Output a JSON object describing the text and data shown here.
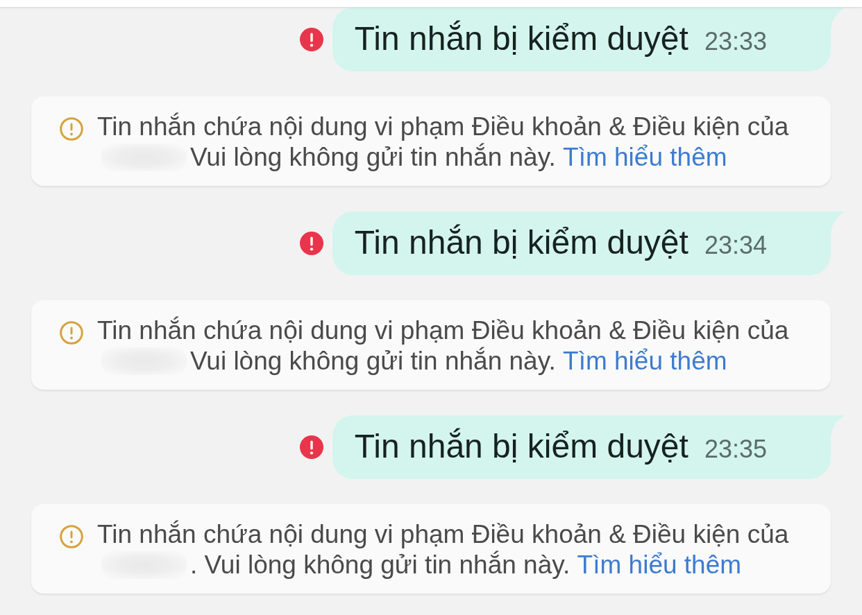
{
  "messages": [
    {
      "text": "Tin nhắn bị kiểm duyệt",
      "time": "23:33",
      "failed": true,
      "notice": {
        "text": "Tin nhắn chứa nội dung vi phạm Điều khoản & Điều kiện của",
        "redacted": true,
        "text_continued": "Vui lòng không gửi tin nhắn này.",
        "link": "Tìm hiểu thêm"
      }
    },
    {
      "text": "Tin nhắn bị kiểm duyệt",
      "time": "23:34",
      "failed": true,
      "notice": {
        "text": "Tin nhắn chứa nội dung vi phạm Điều khoản & Điều kiện của",
        "redacted": true,
        "text_continued": "Vui lòng không gửi tin nhắn này.",
        "link": "Tìm hiểu thêm"
      }
    },
    {
      "text": "Tin nhắn bị kiểm duyệt",
      "time": "23:35",
      "failed": true,
      "notice": {
        "text": "Tin nhắn chứa nội dung vi phạm Điều khoản & Điều kiện của",
        "redacted": true,
        "text_continued": ". Vui lòng không gửi tin nhắn này.",
        "link": "Tìm hiểu thêm"
      }
    }
  ]
}
